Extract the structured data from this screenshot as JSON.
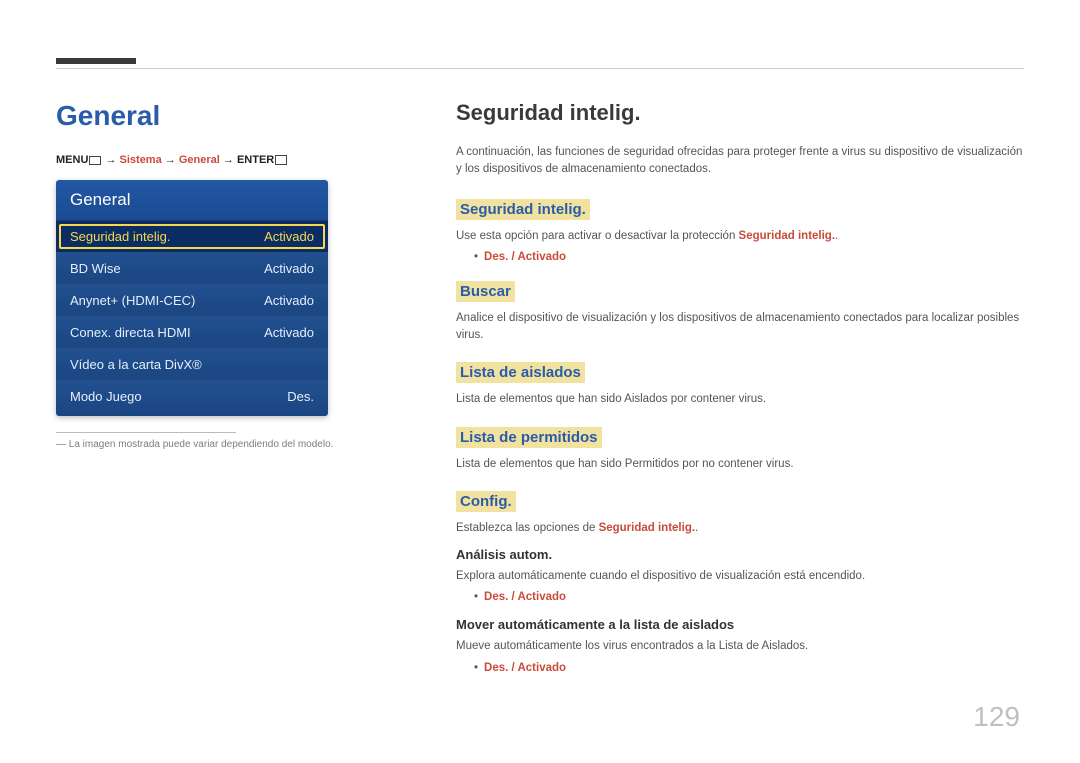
{
  "page_number": "129",
  "left": {
    "title": "General",
    "breadcrumb": {
      "menu": "MENU",
      "arrow": " → ",
      "red1": "Sistema",
      "red2": "General",
      "enter": "ENTER"
    },
    "panel_header": "General",
    "rows": [
      {
        "label": "Seguridad intelig.",
        "value": "Activado",
        "selected": true
      },
      {
        "label": "BD Wise",
        "value": "Activado",
        "selected": false
      },
      {
        "label": "Anynet+ (HDMI-CEC)",
        "value": "Activado",
        "selected": false
      },
      {
        "label": "Conex. directa HDMI",
        "value": "Activado",
        "selected": false
      },
      {
        "label": "Vídeo a la carta DivX®",
        "value": "",
        "selected": false
      },
      {
        "label": "Modo Juego",
        "value": "Des.",
        "selected": false
      }
    ],
    "footnote": "La imagen mostrada puede variar dependiendo del modelo.",
    "footnote_dash": "―"
  },
  "right": {
    "h1": "Seguridad intelig.",
    "intro": "A continuación, las funciones de seguridad ofrecidas para proteger frente a virus su dispositivo de visualización y los dispositivos de almacenamiento conectados.",
    "sec1": {
      "title": "Seguridad intelig.",
      "body_pre": "Use esta opción para activar o desactivar la protección ",
      "body_bold": "Seguridad intelig.",
      "body_post": ".",
      "bullet": "Des. / Activado"
    },
    "sec2": {
      "title": "Buscar",
      "body": "Analice el dispositivo de visualización y los dispositivos de almacenamiento conectados para localizar posibles virus."
    },
    "sec3": {
      "title": "Lista de aislados",
      "body": "Lista de elementos que han sido Aislados por contener virus."
    },
    "sec4": {
      "title": "Lista de permitidos",
      "body": "Lista de elementos que han sido Permitidos por no contener virus."
    },
    "sec5": {
      "title": "Config.",
      "body_pre": "Establezca las opciones de ",
      "body_bold": "Seguridad intelig.",
      "body_post": ".",
      "sub1": {
        "h": "Análisis autom.",
        "body": "Explora automáticamente cuando el dispositivo de visualización está encendido.",
        "bullet": "Des. / Activado"
      },
      "sub2": {
        "h": "Mover automáticamente a la lista de aislados",
        "body": "Mueve automáticamente los virus encontrados a la Lista de Aislados.",
        "bullet": "Des. / Activado"
      }
    }
  }
}
